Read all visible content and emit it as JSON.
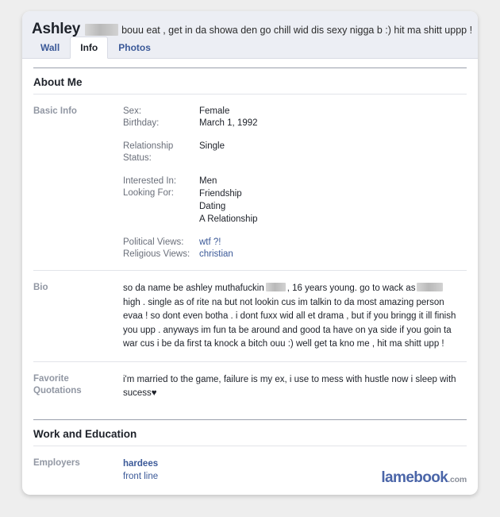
{
  "header": {
    "profile_name": "Ashley",
    "name_redacted": true,
    "status_text": "bouu eat , get in da showa den go chill wid dis sexy nigga b :) hit ma shitt uppp !"
  },
  "tabs": [
    {
      "label": "Wall",
      "active": false
    },
    {
      "label": "Info",
      "active": true
    },
    {
      "label": "Photos",
      "active": false
    }
  ],
  "sections": {
    "about_me": {
      "title": "About Me",
      "basic_info": {
        "label": "Basic Info",
        "fields": [
          {
            "key": "Sex:",
            "value": "Female"
          },
          {
            "key": "Birthday:",
            "value": "March 1, 1992"
          },
          {
            "key": "Relationship Status:",
            "value": "Single"
          },
          {
            "key": "Interested In:",
            "value": "Men"
          },
          {
            "key": "Looking For:",
            "value": "Friendship"
          },
          {
            "key": "Political Views:",
            "value": "wtf ?!"
          },
          {
            "key": "Religious Views:",
            "value": "christian"
          }
        ],
        "looking_for_extra": [
          "Dating",
          "A Relationship"
        ]
      },
      "bio": {
        "label": "Bio",
        "part1": "so da name be ashley muthafuckin",
        "part2": ", 16 years young. go to wack as",
        "part3": "high .",
        "part4": "single as of rite na but not lookin cus im talkin to da most amazing person evaa ! so dont even botha . i dont fuxx wid all et drama , but if you bringg it ill finish you upp . anyways im fun ta be around and good ta have on ya side if you goin ta war cus i be da first ta knock a bitch ouu :) well get ta kno me , hit ma shitt upp !"
      },
      "favorite_quotations": {
        "label_line1": "Favorite",
        "label_line2": "Quotations",
        "text": "i'm married to the game, failure is my ex, i use to mess with hustle now i sleep with sucess",
        "heart": "♥"
      }
    },
    "work_education": {
      "title": "Work and Education",
      "employers": {
        "label": "Employers",
        "name": "hardees",
        "role": "front line"
      }
    }
  },
  "watermark": {
    "main": "lamebook",
    "sub": ".com"
  },
  "colors": {
    "link": "#3b5998",
    "header_band": "#eceef4",
    "label_grey": "#9197a3",
    "watermark_blue": "#4a65a8"
  }
}
